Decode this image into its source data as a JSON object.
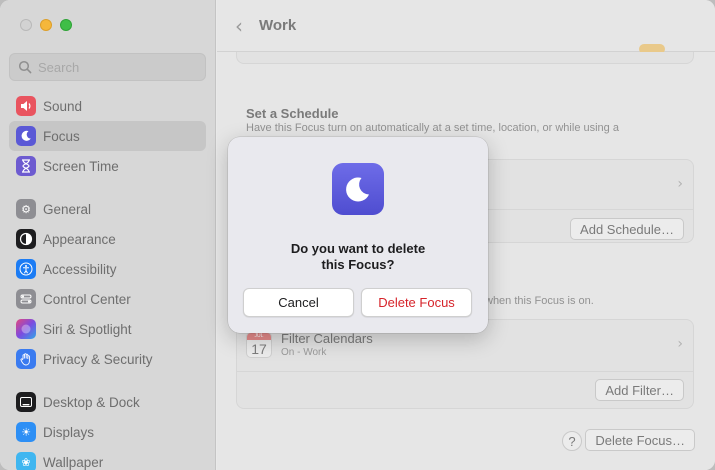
{
  "sidebar": {
    "search_placeholder": "Search",
    "group1": [
      {
        "label": "Sound",
        "icon": "speaker-icon",
        "color": "#e9545f"
      },
      {
        "label": "Focus",
        "icon": "moon-icon",
        "color": "#5b59d6",
        "selected": true
      },
      {
        "label": "Screen Time",
        "icon": "hourglass-icon",
        "color": "#6d5bd0"
      }
    ],
    "group2": [
      {
        "label": "General",
        "icon": "gear-icon",
        "color": "#8e8e93"
      },
      {
        "label": "Appearance",
        "icon": "appearance-icon",
        "color": "#1d1d1f"
      },
      {
        "label": "Accessibility",
        "icon": "accessibility-icon",
        "color": "#1c7cf4"
      },
      {
        "label": "Control Center",
        "icon": "control-center-icon",
        "color": "#8e8e93"
      },
      {
        "label": "Siri & Spotlight",
        "icon": "siri-icon",
        "color": "#b04ad8"
      },
      {
        "label": "Privacy & Security",
        "icon": "hand-icon",
        "color": "#3a7bf0"
      }
    ],
    "group3": [
      {
        "label": "Desktop & Dock",
        "icon": "dock-icon",
        "color": "#1d1d1f"
      },
      {
        "label": "Displays",
        "icon": "sun-icon",
        "color": "#2d8ff5"
      },
      {
        "label": "Wallpaper",
        "icon": "wallpaper-icon",
        "color": "#3fb6f0"
      }
    ]
  },
  "main": {
    "title": "Work",
    "schedule": {
      "title": "Set a Schedule",
      "description": "Have this Focus turn on automatically at a set time, location, or while using a",
      "add_button": "Add Schedule…"
    },
    "filters": {
      "description": "when this Focus is on.",
      "item_name": "Filter Calendars",
      "item_sub": "On - Work",
      "calendar_month": "JUL",
      "calendar_day": "17",
      "add_button": "Add Filter…"
    },
    "help_label": "?",
    "delete_focus_button": "Delete Focus…"
  },
  "dialog": {
    "message_line1": "Do you want to delete",
    "message_line2": "this Focus?",
    "cancel_label": "Cancel",
    "delete_label": "Delete Focus"
  }
}
